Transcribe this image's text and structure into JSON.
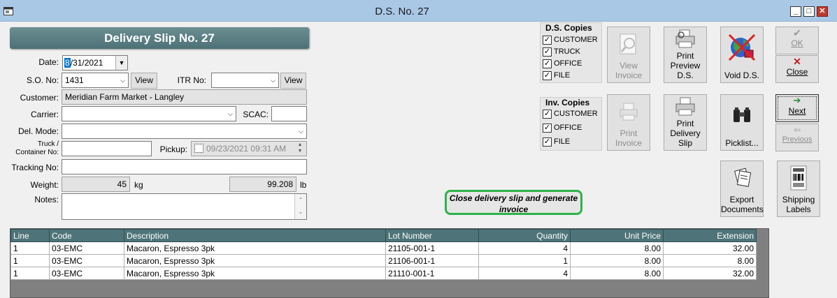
{
  "window": {
    "title": "D.S. No. 27",
    "app_icon": "app-icon",
    "min": "_",
    "max": "□",
    "close": "✕"
  },
  "header": {
    "title": "Delivery Slip No. 27"
  },
  "form": {
    "date_label": "Date:",
    "date_value": "8/31/2021",
    "date_selected_part": "8",
    "date_rest": "/31/2021",
    "so_label": "S.O. No:",
    "so_value": "1431",
    "view_label": "View",
    "itr_label": "ITR No:",
    "itr_value": "",
    "customer_label": "Customer:",
    "customer_value": "Meridian Farm Market - Langley",
    "carrier_label": "Carrier:",
    "carrier_value": "",
    "scac_label": "SCAC:",
    "scac_value": "",
    "delmode_label": "Del. Mode:",
    "delmode_value": "",
    "truck_label_1": "Truck /",
    "truck_label_2": "Container No:",
    "truck_value": "",
    "pickup_label": "Pickup:",
    "pickup_value": "09/23/2021  09:31 AM",
    "tracking_label": "Tracking No:",
    "tracking_value": "",
    "weight_label": "Weight:",
    "weight_kg": "45",
    "weight_kg_unit": "kg",
    "weight_lb": "99.208",
    "weight_lb_unit": "lb",
    "notes_label": "Notes:",
    "notes_value": ""
  },
  "ds_copies": {
    "title": "D.S. Copies",
    "items": [
      {
        "label": "CUSTOMER",
        "checked": true
      },
      {
        "label": "TRUCK",
        "checked": true
      },
      {
        "label": "OFFICE",
        "checked": true
      },
      {
        "label": "FILE",
        "checked": true
      }
    ]
  },
  "inv_copies": {
    "title": "Inv. Copies",
    "items": [
      {
        "label": "CUSTOMER",
        "checked": true
      },
      {
        "label": "OFFICE",
        "checked": true
      },
      {
        "label": "FILE",
        "checked": true
      }
    ]
  },
  "buttons": {
    "view_invoice": [
      "View",
      "Invoice"
    ],
    "print_preview": [
      "Print",
      "Preview",
      "D.S."
    ],
    "void_ds": "Void D.S.",
    "ok": "OK",
    "close": "Close",
    "print_invoice": [
      "Print",
      "Invoice"
    ],
    "print_delivery": [
      "Print",
      "Delivery",
      "Slip"
    ],
    "picklist": "Picklist...",
    "next": "Next",
    "previous": "Previous",
    "export": [
      "Export",
      "Documents"
    ],
    "shipping": [
      "Shipping",
      "Labels"
    ],
    "generate": [
      "Close delivery slip and generate",
      "invoice"
    ]
  },
  "grid": {
    "columns": [
      "Line",
      "Code",
      "Description",
      "Lot Number",
      "Quantity",
      "Unit Price",
      "Extension"
    ],
    "rows": [
      [
        "1",
        "03-EMC",
        "Macaron, Espresso 3pk",
        "21105-001-1",
        "4",
        "8.00",
        "32.00"
      ],
      [
        "1",
        "03-EMC",
        "Macaron, Espresso 3pk",
        "21106-001-1",
        "1",
        "8.00",
        "8.00"
      ],
      [
        "1",
        "03-EMC",
        "Macaron, Espresso 3pk",
        "21110-001-1",
        "4",
        "8.00",
        "32.00"
      ]
    ]
  },
  "colors": {
    "header_band": "#4e7479",
    "title_bar": "#a9c8e6",
    "generate_border": "#2eb34a"
  }
}
